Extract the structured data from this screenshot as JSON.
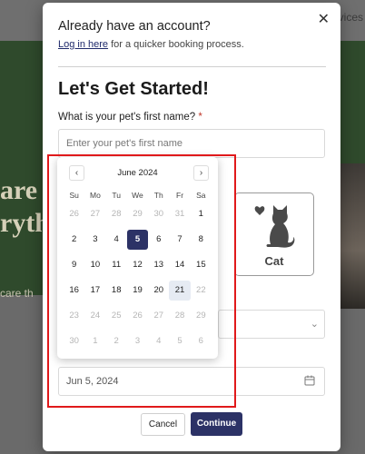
{
  "background": {
    "nav_text": "vices",
    "headline_line1": "are",
    "headline_line2": "ryth",
    "sub_text": "care th"
  },
  "modal": {
    "account_title": "Already have an account?",
    "login_link": "Log in here",
    "login_suffix": " for a quicker booking process.",
    "title": "Let's Get Started!",
    "pet_name_label": "What is your pet's first name?",
    "required_mark": "*",
    "pet_name_placeholder": "Enter your pet's first name",
    "pet_name_value": "",
    "cat_label": "Cat",
    "cat_icon": "cat-icon",
    "date_value": "Jun 5, 2024",
    "cancel_label": "Cancel",
    "continue_label": "Continue"
  },
  "calendar": {
    "month_label": "June 2024",
    "prev": "‹",
    "next": "›",
    "weekdays": [
      "Su",
      "Mo",
      "Tu",
      "We",
      "Th",
      "Fr",
      "Sa"
    ],
    "weeks": [
      [
        {
          "d": "26",
          "muted": true
        },
        {
          "d": "27",
          "muted": true
        },
        {
          "d": "28",
          "muted": true
        },
        {
          "d": "29",
          "muted": true
        },
        {
          "d": "30",
          "muted": true
        },
        {
          "d": "31",
          "muted": true
        },
        {
          "d": "1"
        }
      ],
      [
        {
          "d": "2"
        },
        {
          "d": "3"
        },
        {
          "d": "4"
        },
        {
          "d": "5",
          "selected": true
        },
        {
          "d": "6"
        },
        {
          "d": "7"
        },
        {
          "d": "8"
        }
      ],
      [
        {
          "d": "9"
        },
        {
          "d": "10"
        },
        {
          "d": "11"
        },
        {
          "d": "12"
        },
        {
          "d": "13"
        },
        {
          "d": "14"
        },
        {
          "d": "15"
        }
      ],
      [
        {
          "d": "16"
        },
        {
          "d": "17"
        },
        {
          "d": "18"
        },
        {
          "d": "19"
        },
        {
          "d": "20"
        },
        {
          "d": "21",
          "today": true
        },
        {
          "d": "22",
          "muted": true
        }
      ],
      [
        {
          "d": "23",
          "muted": true
        },
        {
          "d": "24",
          "muted": true
        },
        {
          "d": "25",
          "muted": true
        },
        {
          "d": "26",
          "muted": true
        },
        {
          "d": "27",
          "muted": true
        },
        {
          "d": "28",
          "muted": true
        },
        {
          "d": "29",
          "muted": true
        }
      ],
      [
        {
          "d": "30",
          "muted": true
        },
        {
          "d": "1",
          "muted": true
        },
        {
          "d": "2",
          "muted": true
        },
        {
          "d": "3",
          "muted": true
        },
        {
          "d": "4",
          "muted": true
        },
        {
          "d": "5",
          "muted": true
        },
        {
          "d": "6",
          "muted": true
        }
      ]
    ]
  },
  "colors": {
    "accent": "#2c3266",
    "highlight": "#e0191b"
  }
}
